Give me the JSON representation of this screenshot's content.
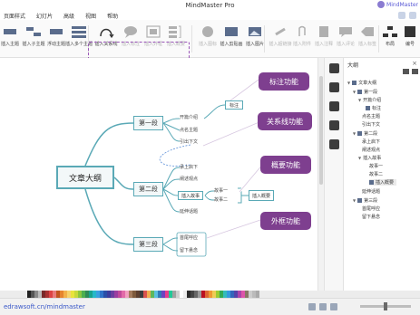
{
  "app": {
    "title": "MindMaster Pro",
    "user": "MindMaster"
  },
  "menu": [
    "页面样式",
    "幻灯片",
    "高级",
    "视图",
    "帮助"
  ],
  "ribbon": {
    "main_tools": [
      "插入主题",
      "插入子主题",
      "浮动主题",
      "插入多个主题"
    ],
    "extra_tools": [
      "插入关系线",
      "插入标注",
      "插入外框",
      "插入概要"
    ],
    "more_tools": [
      "插入图标",
      "插入剪贴画",
      "插入图片",
      "插入超链接",
      "插入附件",
      "插入注释",
      "插入评论",
      "插入标签",
      "布局",
      "编号"
    ]
  },
  "map": {
    "root": "文章大纲",
    "branches": [
      {
        "label": "第一段",
        "children": [
          "开篇介绍",
          "点名主题",
          "引出下文"
        ]
      },
      {
        "label": "第二段",
        "children": [
          "承上启下",
          "阐述观点",
          "插入故事",
          "延伸话题"
        ]
      },
      {
        "label": "第三段",
        "children": [
          "首尾呼应",
          "留下悬念"
        ]
      }
    ],
    "callout": "标注",
    "story_children": [
      "故事一",
      "故事二"
    ],
    "summary": "插入概要"
  },
  "feature_labels": [
    "标注功能",
    "关系线功能",
    "概要功能",
    "外框功能"
  ],
  "outline": {
    "title": "大纲",
    "close": "×",
    "items": [
      "文章大纲",
      "第一段",
      "开篇介绍",
      "标注",
      "点名主题",
      "引出下文",
      "第二段",
      "承上启下",
      "阐述观点",
      "插入故事",
      "故事一",
      "故事二",
      "插入概要",
      "延伸话题",
      "第三段",
      "首尾呼应",
      "留下悬念"
    ]
  },
  "status": {
    "url": "edrawsoft.cn/mindmaster"
  },
  "colors": {
    "accent_purple": "#7e3f8f",
    "node_border": "#5aa9b6",
    "link": "#3a58c8"
  }
}
